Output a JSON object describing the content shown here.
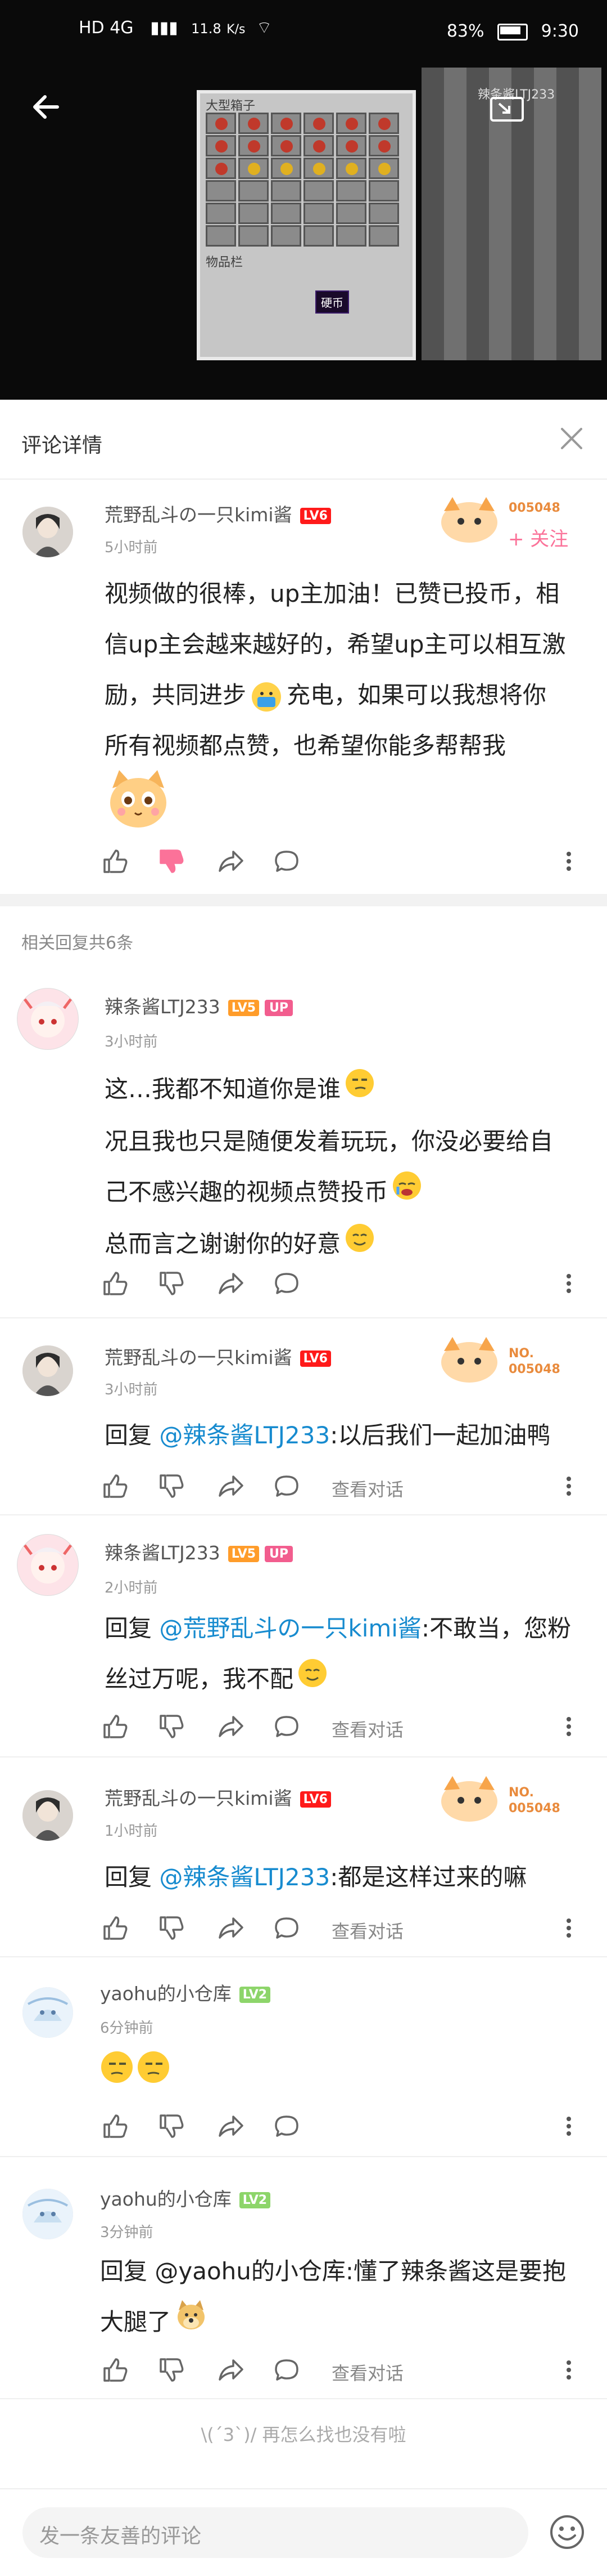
{
  "status_bar": {
    "network_left": "HD 4G",
    "speed": "11.8",
    "speed_unit": "K/s",
    "battery": "83%",
    "time": "9:30"
  },
  "video": {
    "mc_chest_title": "大型箱子",
    "mc_inventory_title": "物品栏",
    "mc_tooltip": "硬币",
    "mc_right_label": "辣条酱LTJ233"
  },
  "header": {
    "title": "评论详情"
  },
  "main_comment": {
    "username": "荒野乱斗の一只kimi酱",
    "level": "LV6",
    "time": "5小时前",
    "fan_no": "005048",
    "follow_label": "+ 关注",
    "text_lines": [
      "视频做的很棒，up主加油！已赞已投币，相",
      "信up主会越来越好的，希望up主可以相互激",
      "励，共同进步",
      "充电，如果可以我想将你",
      "所有视频都点赞，也希望你能多帮帮我"
    ]
  },
  "related_label": "相关回复共6条",
  "replies": [
    {
      "username": "辣条酱LTJ233",
      "level": "LV5",
      "up": "UP",
      "time": "3小时前",
      "lines": [
        "这…我都不知道你是谁",
        "况且我也只是随便发着玩玩，你没必要给自",
        "己不感兴趣的视频点赞投币",
        "总而言之谢谢你的好意"
      ]
    },
    {
      "username": "荒野乱斗の一只kimi酱",
      "level": "LV6",
      "time": "3小时前",
      "fan_no_label": "NO.",
      "fan_no": "005048",
      "reply_prefix": "回复",
      "mention": "@辣条酱LTJ233",
      "text": ":以后我们一起加油鸭",
      "view_conv": "查看对话"
    },
    {
      "username": "辣条酱LTJ233",
      "level": "LV5",
      "up": "UP",
      "time": "2小时前",
      "reply_prefix": "回复",
      "mention": "@荒野乱斗の一只kimi酱",
      "text": ":不敢当，您粉",
      "text2": "丝过万呢，我不配",
      "view_conv": "查看对话"
    },
    {
      "username": "荒野乱斗の一只kimi酱",
      "level": "LV6",
      "time": "1小时前",
      "fan_no_label": "NO.",
      "fan_no": "005048",
      "reply_prefix": "回复",
      "mention": "@辣条酱LTJ233",
      "text": ":都是这样过来的嘛",
      "view_conv": "查看对话"
    },
    {
      "username": "yaohu的小仓库",
      "level": "LV2",
      "time": "6分钟前"
    },
    {
      "username": "yaohu的小仓库",
      "level": "LV2",
      "time": "3分钟前",
      "reply_prefix": "回复",
      "mention_plain": "@yaohu的小仓库",
      "text": ":懂了辣条酱这是要抱",
      "text2": "大腿了",
      "view_conv": "查看对话"
    }
  ],
  "end_text": "\\(ˊ3ˋ)/ 再怎么找也没有啦",
  "bottom": {
    "input_placeholder": "发一条友善的评论"
  },
  "colors": {
    "accent_pink": "#fb7299",
    "mention_blue": "#178bcf",
    "lv6": "#ff1a1a",
    "lv5": "#ff9c2a",
    "lv2": "#8dd56a",
    "up_badge": "#f25d8e"
  },
  "icons": [
    "back-arrow-icon",
    "close-icon",
    "thumb-up-icon",
    "thumb-down-icon",
    "share-icon",
    "comment-icon",
    "more-vertical-icon",
    "emoji-icon"
  ]
}
